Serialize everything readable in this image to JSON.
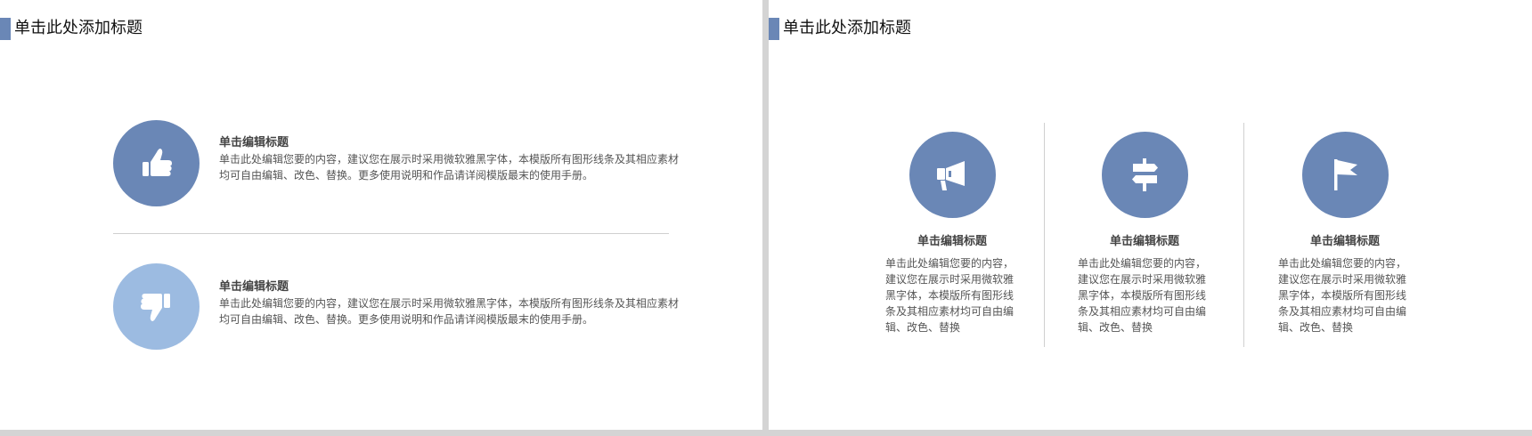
{
  "colors": {
    "accent": "#6a87b6",
    "accent_light": "#9cbbe1",
    "icon_fill": "#ffffff"
  },
  "slide1": {
    "title": "单击此处添加标题",
    "rows": [
      {
        "icon": "thumbs-up-icon",
        "heading": "单击编辑标题",
        "body": "单击此处编辑您要的内容，建议您在展示时采用微软雅黑字体，本模版所有图形线条及其相应素材均可自由编辑、改色、替换。更多使用说明和作品请详阅模版最末的使用手册。"
      },
      {
        "icon": "thumbs-down-icon",
        "heading": "单击编辑标题",
        "body": "单击此处编辑您要的内容，建议您在展示时采用微软雅黑字体，本模版所有图形线条及其相应素材均可自由编辑、改色、替换。更多使用说明和作品请详阅模版最末的使用手册。"
      }
    ]
  },
  "slide2": {
    "title": "单击此处添加标题",
    "columns": [
      {
        "icon": "megaphone-icon",
        "heading": "单击编辑标题",
        "body": "单击此处编辑您要的内容，建议您在展示时采用微软雅黑字体，本模版所有图形线条及其相应素材均可自由编辑、改色、替换"
      },
      {
        "icon": "signpost-icon",
        "heading": "单击编辑标题",
        "body": "单击此处编辑您要的内容，建议您在展示时采用微软雅黑字体，本模版所有图形线条及其相应素材均可自由编辑、改色、替换"
      },
      {
        "icon": "flag-icon",
        "heading": "单击编辑标题",
        "body": "单击此处编辑您要的内容，建议您在展示时采用微软雅黑字体，本模版所有图形线条及其相应素材均可自由编辑、改色、替换"
      }
    ]
  }
}
